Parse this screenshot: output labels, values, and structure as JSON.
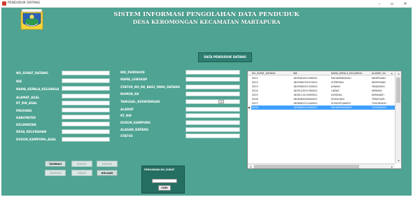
{
  "window": {
    "title": "PENDUDUK DATANG",
    "min_symbol": "–",
    "max_symbol": "▫",
    "close_symbol": "✕"
  },
  "header": {
    "line1": "SISTEM INFORMASI PENGOLAHAN DATA PENDUDUK",
    "line2": "DESA KEROMONGAN KECAMATAN MARTAPURA"
  },
  "section_button": "DATA PENDUDUK DATANG",
  "form_left": [
    "NO_SURAT_DATANG",
    "NIK",
    "NAMA_KEPALA_KELUARGA",
    "ALAMAT_ASAL",
    "RT_RW_ASAL",
    "PROVINSI",
    "KABUPATEN",
    "KECAMATAN",
    "DESA_KELURAHAN",
    "DUSUN_KAMPUNG_ASAL"
  ],
  "form_mid": [
    "NIK_PEMOHON",
    "NAMA_LENGKAP",
    "STATUS_NO_KK_BAGI_YANG_DATANG",
    "NOMOR_KK",
    "TANGGAL_KEDATANGAN",
    "ALAMAT",
    "RT_RW",
    "DUSUN_KAMPUNG",
    "ALASAN_DATANG",
    "STATUS"
  ],
  "grid": {
    "columns": [
      "NO_SURAT_DATANG",
      "NIK",
      "NAMA_KEPALA_KELUARGA",
      "ALAMAT_AS"
    ],
    "rows": [
      [
        "0021",
        "1809061001580002",
        "MUHAMMADHALI",
        "WAYPISANG"
      ],
      [
        "0022",
        "1809060709470001",
        "SUPRIYADI",
        "WAYPISANG"
      ],
      [
        "0023",
        "1809060201550002",
        "JUNAIDI",
        "TANJUNGAI"
      ],
      [
        "0024",
        "1809120201560002",
        "LIAPAS",
        "MERJAYA"
      ],
      [
        "0025",
        "1808121013690001",
        "ASHIDHA",
        "KEBUNJATI"
      ],
      [
        "0026",
        "1808080206640001",
        "EDISUHADI",
        "TEBATSARI"
      ],
      [
        "0027",
        "1808081211040001",
        "SUSILOPUJIANTO",
        "TUGUMULYO"
      ],
      [
        "0028",
        "1808080510480001",
        "MUHAMMADAMIR",
        "TUGUMULYO"
      ]
    ],
    "selected_index": 7
  },
  "buttons": {
    "tambah": "TAMBAH",
    "batal": "BATAL",
    "hapus": "HAPUS",
    "simpan": "SIMPAN",
    "ubah": "UBAH",
    "keluar": "KELUAR"
  },
  "search": {
    "title": "PENCARIAN NO_SURAT",
    "button": "CARI"
  },
  "colors": {
    "background": "#4ea392",
    "section_button": "#2e7f72",
    "search_panel": "#256e62",
    "selection": "#3f9fff"
  }
}
